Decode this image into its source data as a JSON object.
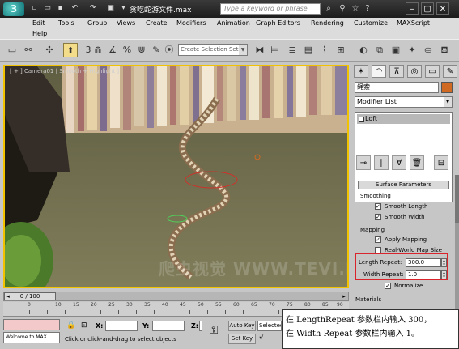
{
  "titlebar": {
    "title": "贪吃蛇游文件.max",
    "search_placeholder": "Type a keyword or phrase"
  },
  "menu": {
    "items": [
      "Edit",
      "Tools",
      "Group",
      "Views",
      "Create",
      "Modifiers",
      "Animation",
      "Graph Editors",
      "Rendering",
      "Customize",
      "MAXScript",
      "Help"
    ]
  },
  "toolbar": {
    "selection_set_placeholder": "Create Selection Set",
    "counter": "3"
  },
  "viewport": {
    "label": "[ + ] Camera01 | Smooth + Highlight ]",
    "watermark": "爬虫视觉 WWW.TEVI.NET"
  },
  "timeline": {
    "frame": "0 / 100",
    "ticks": [
      "0",
      "10",
      "15",
      "20",
      "25",
      "30",
      "35",
      "40",
      "45",
      "50",
      "55",
      "60",
      "65",
      "70",
      "75",
      "80",
      "85",
      "90"
    ]
  },
  "status": {
    "welcome": "Welcome to MAX",
    "prompt": "Click or click-and-drag to select objects",
    "x_label": "X:",
    "y_label": "Y:",
    "z_label": "Z:",
    "auto_key": "Auto Key",
    "set_key": "Set Key",
    "selected": "Selected"
  },
  "command_panel": {
    "object_name": "绳索",
    "object_color": "#d06a22",
    "modifier_list": "Modifier List",
    "stack_item": "Loft",
    "rollout_title": "Surface Parameters",
    "smoothing": {
      "title": "Smoothing",
      "smooth_length": "Smooth Length",
      "smooth_width": "Smooth Width",
      "smooth_length_checked": true,
      "smooth_width_checked": true
    },
    "mapping": {
      "title": "Mapping",
      "apply_mapping": "Apply Mapping",
      "real_world": "Real-World Map Size",
      "apply_mapping_checked": true,
      "real_world_checked": false,
      "length_repeat_label": "Length Repeat:",
      "length_repeat_value": "300.0",
      "width_repeat_label": "Width Repeat:",
      "width_repeat_value": "1.0",
      "normalize": "Normalize",
      "normalize_checked": true
    },
    "materials_title": "Materials"
  },
  "caption": {
    "line1": "在 LengthRepeat 参数栏内输入 300，",
    "line2": "在 Width Repeat 参数栏内输入 1。"
  }
}
